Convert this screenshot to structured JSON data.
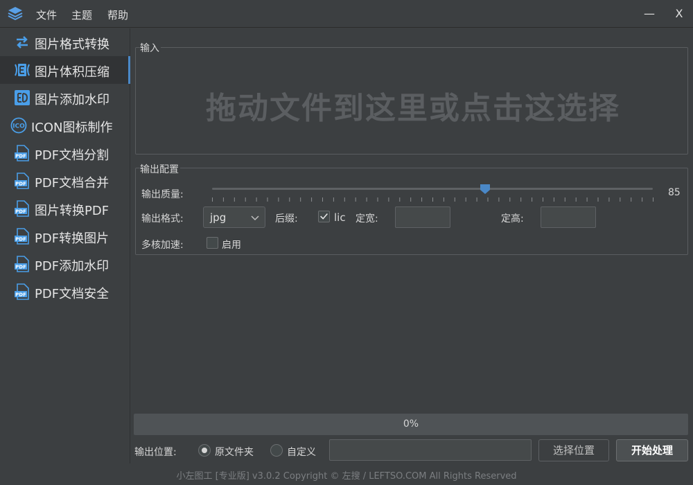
{
  "menu": {
    "file": "文件",
    "theme": "主题",
    "help": "帮助"
  },
  "window": {
    "minimize": "—",
    "close": "X"
  },
  "sidebar": {
    "items": [
      {
        "label": "图片格式转换",
        "icon": "convert-arrows-icon"
      },
      {
        "label": "图片体积压缩",
        "icon": "compress-icon"
      },
      {
        "label": "图片添加水印",
        "icon": "watermark-icon"
      },
      {
        "label": "ICON图标制作",
        "icon": "ico-icon"
      },
      {
        "label": "PDF文档分割",
        "icon": "pdf-icon"
      },
      {
        "label": "PDF文档合并",
        "icon": "pdf-icon"
      },
      {
        "label": "图片转换PDF",
        "icon": "pdf-icon"
      },
      {
        "label": "PDF转换图片",
        "icon": "pdf-icon"
      },
      {
        "label": "PDF添加水印",
        "icon": "pdf-icon"
      },
      {
        "label": "PDF文档安全",
        "icon": "pdf-icon"
      }
    ],
    "active_index": 1,
    "accent": "#4a88c7"
  },
  "input_group": {
    "title": "输入",
    "drop_hint": "拖动文件到这里或点击这选择"
  },
  "output_config": {
    "title": "输出配置",
    "quality_label": "输出质量:",
    "quality_value": "85",
    "quality_fraction": 0.62,
    "format_label": "输出格式:",
    "format_value": "jpg",
    "suffix_label": "后缀:",
    "suffix_checkbox_label": "lic",
    "suffix_checked": true,
    "width_label": "定宽:",
    "height_label": "定高:",
    "multicore_label": "多核加速:",
    "multicore_checkbox_label": "启用",
    "multicore_checked": false
  },
  "progress": {
    "text": "0%",
    "value": 0
  },
  "output_location": {
    "label": "输出位置:",
    "option_original": "原文件夹",
    "option_custom": "自定义",
    "selected": "original",
    "path_value": "",
    "choose_button": "选择位置",
    "start_button": "开始处理"
  },
  "footer": "小左图工 [专业版]  v3.0.2 Copyright © 左搜 / LEFTSO.COM All Rights Reserved"
}
